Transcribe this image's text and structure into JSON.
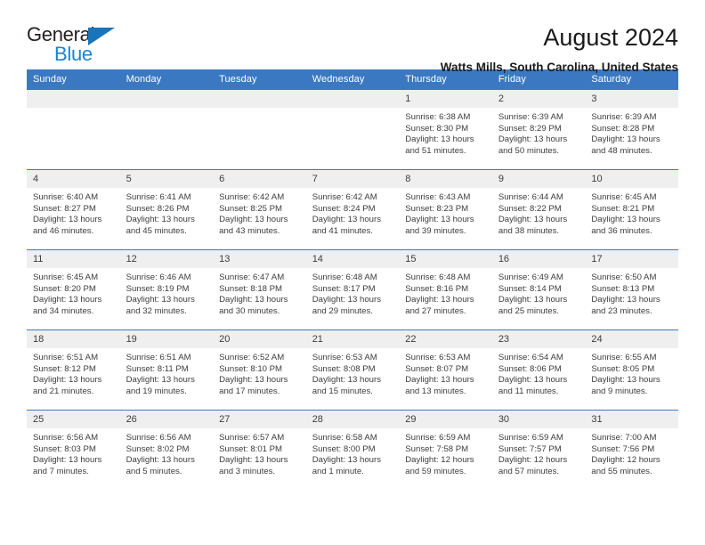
{
  "logo": {
    "word_top": "General",
    "word_bottom": "Blue",
    "triangle_color": "#1a74bb",
    "blue_text_color": "#1a83d6"
  },
  "header": {
    "title": "August 2024",
    "subtitle": "Watts Mills, South Carolina, United States"
  },
  "theme": {
    "header_bar": "#3a79c2",
    "daynum_bg": "#efefef",
    "text": "#3d3d3d"
  },
  "weekday_headers": [
    "Sunday",
    "Monday",
    "Tuesday",
    "Wednesday",
    "Thursday",
    "Friday",
    "Saturday"
  ],
  "weeks": [
    [
      {
        "day": "",
        "sunrise": "",
        "sunset": "",
        "daylight_line1": "",
        "daylight_line2": ""
      },
      {
        "day": "",
        "sunrise": "",
        "sunset": "",
        "daylight_line1": "",
        "daylight_line2": ""
      },
      {
        "day": "",
        "sunrise": "",
        "sunset": "",
        "daylight_line1": "",
        "daylight_line2": ""
      },
      {
        "day": "",
        "sunrise": "",
        "sunset": "",
        "daylight_line1": "",
        "daylight_line2": ""
      },
      {
        "day": "1",
        "sunrise": "Sunrise: 6:38 AM",
        "sunset": "Sunset: 8:30 PM",
        "daylight_line1": "Daylight: 13 hours",
        "daylight_line2": "and 51 minutes."
      },
      {
        "day": "2",
        "sunrise": "Sunrise: 6:39 AM",
        "sunset": "Sunset: 8:29 PM",
        "daylight_line1": "Daylight: 13 hours",
        "daylight_line2": "and 50 minutes."
      },
      {
        "day": "3",
        "sunrise": "Sunrise: 6:39 AM",
        "sunset": "Sunset: 8:28 PM",
        "daylight_line1": "Daylight: 13 hours",
        "daylight_line2": "and 48 minutes."
      }
    ],
    [
      {
        "day": "4",
        "sunrise": "Sunrise: 6:40 AM",
        "sunset": "Sunset: 8:27 PM",
        "daylight_line1": "Daylight: 13 hours",
        "daylight_line2": "and 46 minutes."
      },
      {
        "day": "5",
        "sunrise": "Sunrise: 6:41 AM",
        "sunset": "Sunset: 8:26 PM",
        "daylight_line1": "Daylight: 13 hours",
        "daylight_line2": "and 45 minutes."
      },
      {
        "day": "6",
        "sunrise": "Sunrise: 6:42 AM",
        "sunset": "Sunset: 8:25 PM",
        "daylight_line1": "Daylight: 13 hours",
        "daylight_line2": "and 43 minutes."
      },
      {
        "day": "7",
        "sunrise": "Sunrise: 6:42 AM",
        "sunset": "Sunset: 8:24 PM",
        "daylight_line1": "Daylight: 13 hours",
        "daylight_line2": "and 41 minutes."
      },
      {
        "day": "8",
        "sunrise": "Sunrise: 6:43 AM",
        "sunset": "Sunset: 8:23 PM",
        "daylight_line1": "Daylight: 13 hours",
        "daylight_line2": "and 39 minutes."
      },
      {
        "day": "9",
        "sunrise": "Sunrise: 6:44 AM",
        "sunset": "Sunset: 8:22 PM",
        "daylight_line1": "Daylight: 13 hours",
        "daylight_line2": "and 38 minutes."
      },
      {
        "day": "10",
        "sunrise": "Sunrise: 6:45 AM",
        "sunset": "Sunset: 8:21 PM",
        "daylight_line1": "Daylight: 13 hours",
        "daylight_line2": "and 36 minutes."
      }
    ],
    [
      {
        "day": "11",
        "sunrise": "Sunrise: 6:45 AM",
        "sunset": "Sunset: 8:20 PM",
        "daylight_line1": "Daylight: 13 hours",
        "daylight_line2": "and 34 minutes."
      },
      {
        "day": "12",
        "sunrise": "Sunrise: 6:46 AM",
        "sunset": "Sunset: 8:19 PM",
        "daylight_line1": "Daylight: 13 hours",
        "daylight_line2": "and 32 minutes."
      },
      {
        "day": "13",
        "sunrise": "Sunrise: 6:47 AM",
        "sunset": "Sunset: 8:18 PM",
        "daylight_line1": "Daylight: 13 hours",
        "daylight_line2": "and 30 minutes."
      },
      {
        "day": "14",
        "sunrise": "Sunrise: 6:48 AM",
        "sunset": "Sunset: 8:17 PM",
        "daylight_line1": "Daylight: 13 hours",
        "daylight_line2": "and 29 minutes."
      },
      {
        "day": "15",
        "sunrise": "Sunrise: 6:48 AM",
        "sunset": "Sunset: 8:16 PM",
        "daylight_line1": "Daylight: 13 hours",
        "daylight_line2": "and 27 minutes."
      },
      {
        "day": "16",
        "sunrise": "Sunrise: 6:49 AM",
        "sunset": "Sunset: 8:14 PM",
        "daylight_line1": "Daylight: 13 hours",
        "daylight_line2": "and 25 minutes."
      },
      {
        "day": "17",
        "sunrise": "Sunrise: 6:50 AM",
        "sunset": "Sunset: 8:13 PM",
        "daylight_line1": "Daylight: 13 hours",
        "daylight_line2": "and 23 minutes."
      }
    ],
    [
      {
        "day": "18",
        "sunrise": "Sunrise: 6:51 AM",
        "sunset": "Sunset: 8:12 PM",
        "daylight_line1": "Daylight: 13 hours",
        "daylight_line2": "and 21 minutes."
      },
      {
        "day": "19",
        "sunrise": "Sunrise: 6:51 AM",
        "sunset": "Sunset: 8:11 PM",
        "daylight_line1": "Daylight: 13 hours",
        "daylight_line2": "and 19 minutes."
      },
      {
        "day": "20",
        "sunrise": "Sunrise: 6:52 AM",
        "sunset": "Sunset: 8:10 PM",
        "daylight_line1": "Daylight: 13 hours",
        "daylight_line2": "and 17 minutes."
      },
      {
        "day": "21",
        "sunrise": "Sunrise: 6:53 AM",
        "sunset": "Sunset: 8:08 PM",
        "daylight_line1": "Daylight: 13 hours",
        "daylight_line2": "and 15 minutes."
      },
      {
        "day": "22",
        "sunrise": "Sunrise: 6:53 AM",
        "sunset": "Sunset: 8:07 PM",
        "daylight_line1": "Daylight: 13 hours",
        "daylight_line2": "and 13 minutes."
      },
      {
        "day": "23",
        "sunrise": "Sunrise: 6:54 AM",
        "sunset": "Sunset: 8:06 PM",
        "daylight_line1": "Daylight: 13 hours",
        "daylight_line2": "and 11 minutes."
      },
      {
        "day": "24",
        "sunrise": "Sunrise: 6:55 AM",
        "sunset": "Sunset: 8:05 PM",
        "daylight_line1": "Daylight: 13 hours",
        "daylight_line2": "and 9 minutes."
      }
    ],
    [
      {
        "day": "25",
        "sunrise": "Sunrise: 6:56 AM",
        "sunset": "Sunset: 8:03 PM",
        "daylight_line1": "Daylight: 13 hours",
        "daylight_line2": "and 7 minutes."
      },
      {
        "day": "26",
        "sunrise": "Sunrise: 6:56 AM",
        "sunset": "Sunset: 8:02 PM",
        "daylight_line1": "Daylight: 13 hours",
        "daylight_line2": "and 5 minutes."
      },
      {
        "day": "27",
        "sunrise": "Sunrise: 6:57 AM",
        "sunset": "Sunset: 8:01 PM",
        "daylight_line1": "Daylight: 13 hours",
        "daylight_line2": "and 3 minutes."
      },
      {
        "day": "28",
        "sunrise": "Sunrise: 6:58 AM",
        "sunset": "Sunset: 8:00 PM",
        "daylight_line1": "Daylight: 13 hours",
        "daylight_line2": "and 1 minute."
      },
      {
        "day": "29",
        "sunrise": "Sunrise: 6:59 AM",
        "sunset": "Sunset: 7:58 PM",
        "daylight_line1": "Daylight: 12 hours",
        "daylight_line2": "and 59 minutes."
      },
      {
        "day": "30",
        "sunrise": "Sunrise: 6:59 AM",
        "sunset": "Sunset: 7:57 PM",
        "daylight_line1": "Daylight: 12 hours",
        "daylight_line2": "and 57 minutes."
      },
      {
        "day": "31",
        "sunrise": "Sunrise: 7:00 AM",
        "sunset": "Sunset: 7:56 PM",
        "daylight_line1": "Daylight: 12 hours",
        "daylight_line2": "and 55 minutes."
      }
    ]
  ]
}
